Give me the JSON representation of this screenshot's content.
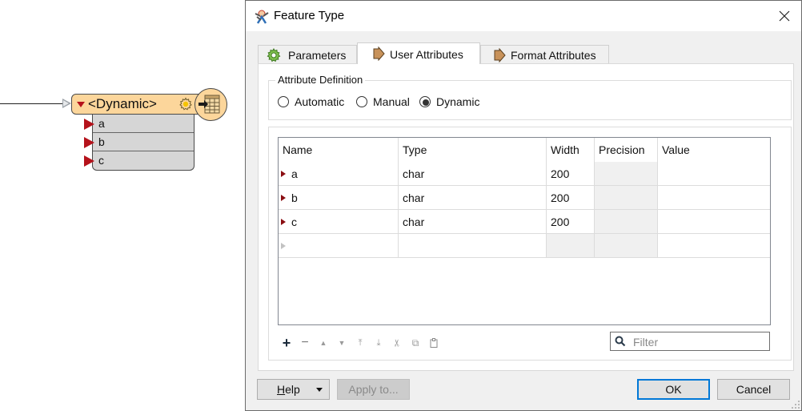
{
  "canvas": {
    "node": {
      "title": "<Dynamic>",
      "attributes": [
        "a",
        "b",
        "c"
      ],
      "header_color": "#fcd69b",
      "port_color": "#b5121b"
    }
  },
  "dialog": {
    "title": "Feature Type",
    "close_label": "×",
    "tabs": [
      {
        "label": "Parameters",
        "icon": "gear-icon",
        "active": false
      },
      {
        "label": "User Attributes",
        "icon": "arrow-icon",
        "active": true
      },
      {
        "label": "Format Attributes",
        "icon": "arrow-icon",
        "active": false
      }
    ],
    "attribute_definition": {
      "title": "Attribute Definition",
      "options": [
        {
          "label": "Automatic",
          "selected": false
        },
        {
          "label": "Manual",
          "selected": false
        },
        {
          "label": "Dynamic",
          "selected": true
        }
      ]
    },
    "table": {
      "columns": [
        "Name",
        "Type",
        "Width",
        "Precision",
        "Value"
      ],
      "rows": [
        {
          "name": "a",
          "type": "char",
          "width": "200",
          "precision": "",
          "value": ""
        },
        {
          "name": "b",
          "type": "char",
          "width": "200",
          "precision": "",
          "value": ""
        },
        {
          "name": "c",
          "type": "char",
          "width": "200",
          "precision": "",
          "value": ""
        },
        {
          "name": "",
          "type": "",
          "width": "",
          "precision": "",
          "value": ""
        }
      ]
    },
    "toolbar": {
      "add": "+",
      "remove": "−",
      "move_up": "▲",
      "move_down": "▼",
      "move_top": "⤒",
      "move_bottom": "⤓",
      "cut": "✂",
      "copy": "⧉",
      "paste": "📋"
    },
    "filter": {
      "placeholder": "Filter",
      "value": ""
    },
    "buttons": {
      "help": "Help",
      "apply_to": "Apply to...",
      "ok": "OK",
      "cancel": "Cancel"
    },
    "accent_color": "#0078d7"
  }
}
